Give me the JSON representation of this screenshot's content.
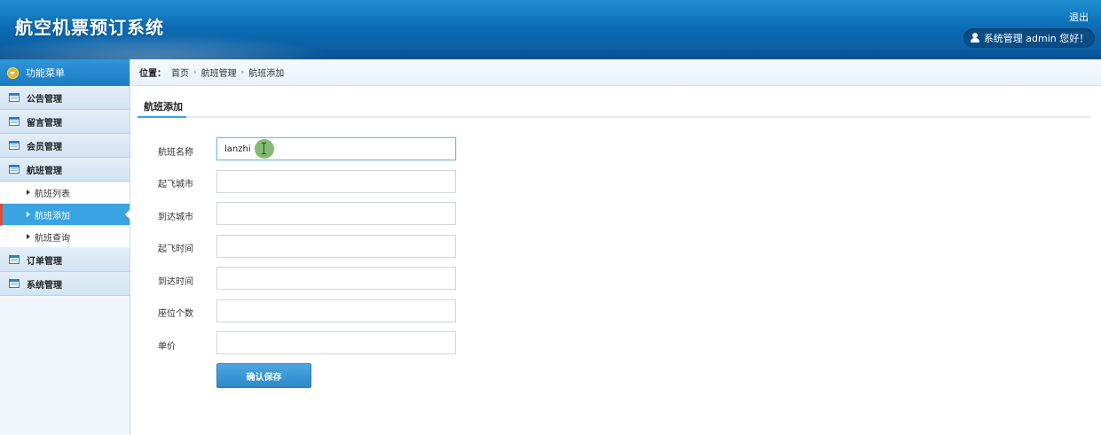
{
  "header": {
    "app_title": "航空机票预订系统",
    "logout_label": "退出",
    "user_greeting": "系统管理 admin 您好！"
  },
  "sidebar": {
    "menu_title": "功能菜单",
    "groups": [
      {
        "label": "公告管理"
      },
      {
        "label": "留言管理"
      },
      {
        "label": "会员管理"
      },
      {
        "label": "航班管理",
        "sub_items": [
          {
            "label": "航班列表"
          },
          {
            "label": "航班添加",
            "active": true
          },
          {
            "label": "航班查询"
          }
        ]
      },
      {
        "label": "订单管理"
      },
      {
        "label": "系统管理"
      }
    ]
  },
  "breadcrumb": {
    "location_label": "位置：",
    "items": [
      "首页",
      "航班管理",
      "航班添加"
    ],
    "separator": "›"
  },
  "page": {
    "section_title": "航班添加"
  },
  "form": {
    "fields": [
      {
        "label": "航班名称",
        "value": "lanzhi"
      },
      {
        "label": "起飞城市",
        "value": ""
      },
      {
        "label": "到达城市",
        "value": ""
      },
      {
        "label": "起飞时间",
        "value": ""
      },
      {
        "label": "到达时间",
        "value": ""
      },
      {
        "label": "座位个数",
        "value": ""
      },
      {
        "label": "单价",
        "value": ""
      }
    ],
    "submit_label": "确认保存"
  },
  "colors": {
    "header_blue": "#0c6db5",
    "accent_blue": "#3aa4e3",
    "active_marker_red": "#e04a3b",
    "menu_icon_gold": "#e5b323"
  }
}
